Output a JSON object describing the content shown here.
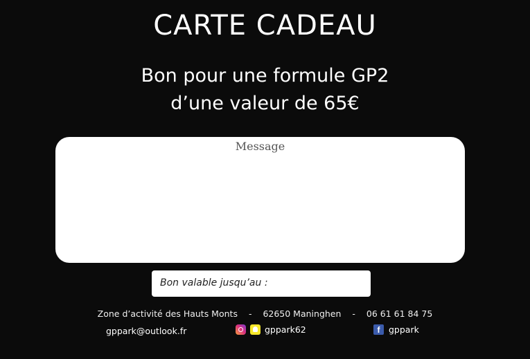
{
  "card": {
    "title": "CARTE CADEAU",
    "offer_line1": "Bon pour une formule GP2",
    "offer_line2": "d’une valeur de 65€",
    "message_label": "Message",
    "validity_label": "Bon valable jusqu’au :"
  },
  "footer": {
    "address": "Zone d’activité des Hauts Monts",
    "postal": "62650 Maninghen",
    "phone": "06 61 61 84 75",
    "separator": "-",
    "email": "gppark@outlook.fr",
    "instagram_snapchat": "gppark62",
    "facebook": "gppark",
    "icons": [
      "instagram-icon",
      "snapchat-icon",
      "facebook-icon"
    ]
  },
  "colors": {
    "background": "#0b0b0b",
    "text": "#ffffff",
    "facebook": "#3b5bab",
    "snapchat": "#f7e82a"
  }
}
